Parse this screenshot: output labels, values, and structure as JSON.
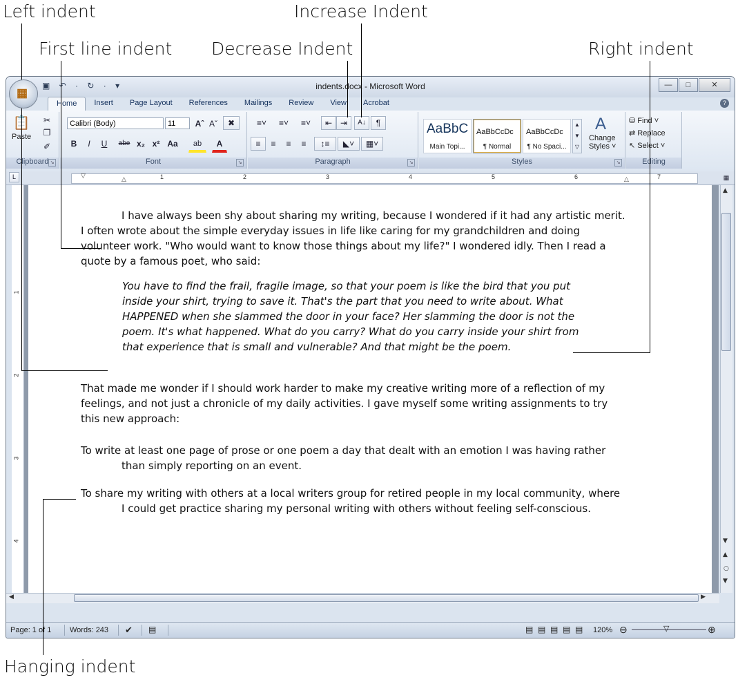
{
  "callouts": {
    "left_indent": "Left indent",
    "increase_indent": "Increase Indent",
    "first_line_indent": "First line indent",
    "decrease_indent": "Decrease Indent",
    "right_indent": "Right indent",
    "hanging_indent": "Hanging indent"
  },
  "window": {
    "title": "indents.docx - Microsoft Word",
    "office_button_icon": "office-logo-icon",
    "quick_access": "▣ ↶ · ↻ · ▾"
  },
  "tabs": [
    "Home",
    "Insert",
    "Page Layout",
    "References",
    "Mailings",
    "Review",
    "View",
    "Acrobat"
  ],
  "ribbon": {
    "clipboard": {
      "label": "Clipboard",
      "paste": "Paste"
    },
    "font": {
      "label": "Font",
      "name": "Calibri (Body)",
      "size": "11",
      "bold": "B",
      "italic": "I",
      "underline": "U",
      "strike": "abe",
      "sub": "x₂",
      "sup": "x²",
      "case": "Aa",
      "grow": "Aˆ",
      "shrink": "Aˇ",
      "highlight": "ab",
      "color": "A"
    },
    "paragraph": {
      "label": "Paragraph"
    },
    "styles": {
      "label": "Styles",
      "items": [
        {
          "sample": "AaBbC",
          "name": "Main Topi..."
        },
        {
          "sample": "AaBbCcDc",
          "name": "¶ Normal"
        },
        {
          "sample": "AaBbCcDc",
          "name": "¶ No Spaci..."
        }
      ],
      "change": "Change",
      "change2": "Styles ˅"
    },
    "editing": {
      "label": "Editing",
      "find": "Find ˅",
      "replace": "Replace",
      "select": "Select ˅"
    }
  },
  "ruler": {
    "numbers": [
      "1",
      "2",
      "3",
      "4",
      "5",
      "6",
      "7"
    ],
    "vnumbers": [
      "1",
      "2",
      "3",
      "4"
    ]
  },
  "document": {
    "p1": [
      "I have always been shy about sharing my writing, because I wondered if it had any artistic merit.",
      "I often wrote about the simple everyday issues in life like caring for my grandchildren and doing",
      "volunteer work. \"Who would want to know those things about my life?\" I wondered idly. Then I read a",
      "quote by a famous poet, who said:"
    ],
    "quote": [
      "You have to find the frail, fragile image, so that your poem is like the bird that you put",
      "inside your shirt, trying to save it. That's the part that you need to write about. What",
      "HAPPENED when she slammed the door in your face?  Her slamming the door is not the",
      "poem. It's what happened. What do you carry? What do you carry inside your shirt from",
      "that experience that is small and vulnerable?  And that might be the poem."
    ],
    "p2": [
      "That made me wonder if I should work harder to make my creative writing more of a reflection of my",
      "feelings, and not just a chronicle of my daily activities.  I gave myself some writing assignments to try",
      "this new approach:"
    ],
    "p3": [
      "To write at least one page of prose or one poem a day that dealt with an emotion I was having rather",
      "than simply reporting on an event."
    ],
    "p4": [
      "To share my writing with others at a local writers group for retired people in my local community, where",
      "I could get practice sharing my personal writing with others without feeling self-conscious."
    ]
  },
  "status": {
    "page": "Page: 1 of 1",
    "words": "Words: 243",
    "zoom": "120%"
  }
}
